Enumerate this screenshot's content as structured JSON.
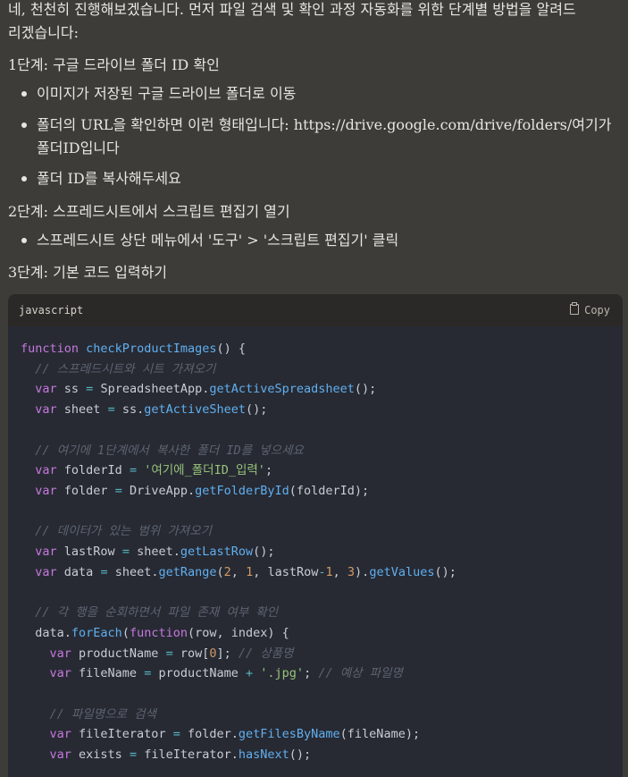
{
  "intro": "네, 천천히 진행해보겠습니다. 먼저 파일 검색 및 확인 과정 자동화를 위한 단계별 방법을 알려드리겠습니다:",
  "intro_line1": "네, 천천히 진행해보겠습니다. 먼저 파일 검색 및 확인 과정 자동화를 위한 단계별 방법을 알려드",
  "intro_line2": "리겠습니다:",
  "steps": [
    {
      "title": "1단계: 구글 드라이브 폴더 ID 확인",
      "bullets": [
        "이미지가 저장된 구글 드라이브 폴더로 이동",
        "폴더의 URL을 확인하면 이런 형태입니다: https://drive.google.com/drive/folders/여기가",
        "폴더ID입니다",
        "폴더 ID를 복사해두세요"
      ]
    },
    {
      "title": "2단계: 스프레드시트에서 스크립트 편집기 열기",
      "bullets": [
        "스프레드시트 상단 메뉴에서 '도구' > '스크립트 편집기' 클릭"
      ]
    },
    {
      "title": "3단계: 기본 코드 입력하기",
      "bullets": []
    }
  ],
  "code_block": {
    "language": "javascript",
    "copy_label": "Copy",
    "copy_icon": "clipboard-icon",
    "lines": [
      "function checkProductImages() {",
      "  // 스프레드시트와 시트 가져오기",
      "  var ss = SpreadsheetApp.getActiveSpreadsheet();",
      "  var sheet = ss.getActiveSheet();",
      "",
      "  // 여기에 1단계에서 복사한 폴더 ID를 넣으세요",
      "  var folderId = '여기에_폴더ID_입력';",
      "  var folder = DriveApp.getFolderById(folderId);",
      "",
      "  // 데이터가 있는 범위 가져오기",
      "  var lastRow = sheet.getLastRow();",
      "  var data = sheet.getRange(2, 1, lastRow-1, 3).getValues();",
      "",
      "  // 각 행을 순회하면서 파일 존재 여부 확인",
      "  data.forEach(function(row, index) {",
      "    var productName = row[0]; // 상품명",
      "    var fileName = productName + '.jpg'; // 예상 파일명",
      "",
      "    // 파일명으로 검색",
      "    var fileIterator = folder.getFilesByName(fileName);",
      "    var exists = fileIterator.hasNext();"
    ]
  },
  "colors": {
    "background": "#3d3c38",
    "code_header": "#2a2927",
    "code_body": "#272a33",
    "keyword": "#c678dd",
    "function": "#61afef",
    "comment": "#5c6370",
    "string": "#98c379",
    "number": "#d19a66"
  }
}
